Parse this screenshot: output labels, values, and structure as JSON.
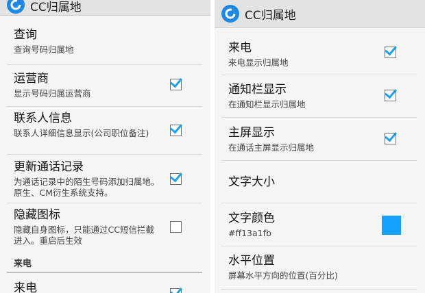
{
  "app": {
    "title": "CC归属地"
  },
  "left": {
    "items": [
      {
        "title": "查询",
        "summary": "查询号码归属地"
      },
      {
        "title": "运营商",
        "summary": "显示号码归属运营商",
        "checked": true
      },
      {
        "title": "联系人信息",
        "summary": "联系人详细信息显示(公司职位备注)",
        "checked": true
      },
      {
        "title": "更新通话记录",
        "summary": "为通话记录中的陌生号码添加归属地。原生、CM衍生系统支持。",
        "checked": true
      },
      {
        "title": "隐藏图标",
        "summary": "隐藏自身图标，只能通过CC短信拦截进入。重启后生效",
        "checked": false
      }
    ],
    "category": "来电",
    "partial_item": {
      "title": "来电",
      "checked": true
    }
  },
  "right": {
    "items": [
      {
        "title": "来电",
        "summary": "来电显示归属地",
        "checked": true
      },
      {
        "title": "通知栏显示",
        "summary": "在通知栏显示归属地",
        "checked": true
      },
      {
        "title": "主屏显示",
        "summary": "在通话主屏显示归属地",
        "checked": true
      },
      {
        "title": "文字大小"
      },
      {
        "title": "文字颜色",
        "summary": "#ff13a1fb",
        "swatch_color": "#13a1fb"
      },
      {
        "title": "水平位置",
        "summary": "屏幕水平方向的位置(百分比)"
      }
    ]
  },
  "colors": {
    "accent": "#13a1fb",
    "appbar": "#e3e3e3",
    "background": "#f5f5f5"
  }
}
